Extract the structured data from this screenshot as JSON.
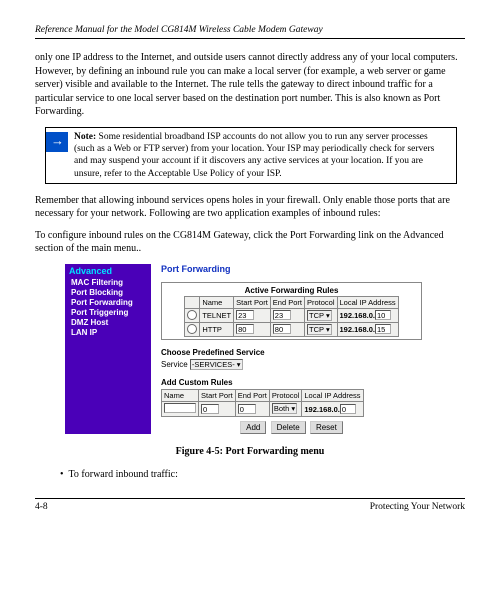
{
  "header": "Reference Manual for the Model CG814M Wireless Cable Modem Gateway",
  "para1": "only one IP address to the Internet, and outside users cannot directly address any of your local computers. However, by defining an inbound rule you can make a local server (for example, a web server or game server) visible and available to the Internet. The rule tells the gateway to direct inbound traffic for a particular service to one local server based on the destination port number. This is also known as Port Forwarding.",
  "note_label": "Note:",
  "note_body": " Some residential broadband ISP accounts do not allow you to run any server processes (such as a Web or FTP server) from your location. Your ISP may periodically check for servers and may suspend your account if it discovers any active services at your location. If you are unsure, refer to the Acceptable Use Policy of your ISP.",
  "para2": "Remember that allowing inbound services opens holes in your firewall. Only enable those ports that are necessary for your network. Following are two application examples of inbound rules:",
  "para3": "To configure inbound rules on the CG814M Gateway, click the Port Forwarding link on the Advanced section of the main menu..",
  "sidebar": {
    "title": "Advanced",
    "items": [
      "MAC Filtering",
      "Port Blocking",
      "Port Forwarding",
      "Port Triggering",
      "DMZ Host",
      "LAN IP"
    ]
  },
  "panel": {
    "title": "Port Forwarding",
    "active_title": "Active Forwarding Rules",
    "cols": [
      "",
      "Name",
      "Start Port",
      "End Port",
      "Protocol",
      "Local IP Address"
    ],
    "rows": [
      {
        "name": "TELNET",
        "start": "23",
        "end": "23",
        "proto": "TCP",
        "ip_prefix": "192.168.0.",
        "ip_last": "10"
      },
      {
        "name": "HTTP",
        "start": "80",
        "end": "80",
        "proto": "TCP",
        "ip_prefix": "192.168.0.",
        "ip_last": "15"
      }
    ],
    "predef_label": "Choose Predefined Service",
    "service_label": "Service",
    "service_value": "-SERVICES-",
    "custom_label": "Add Custom Rules",
    "custom_cols": [
      "Name",
      "Start Port",
      "End Port",
      "Protocol",
      "Local IP Address"
    ],
    "custom": {
      "name": "",
      "start": "0",
      "end": "0",
      "proto": "Both",
      "ip_prefix": "192.168.0.",
      "ip_last": "0"
    },
    "buttons": [
      "Add",
      "Delete",
      "Reset"
    ]
  },
  "caption": "Figure 4-5: Port Forwarding menu",
  "bullet": "To forward inbound traffic:",
  "footer_left": "4-8",
  "footer_right": "Protecting Your Network"
}
